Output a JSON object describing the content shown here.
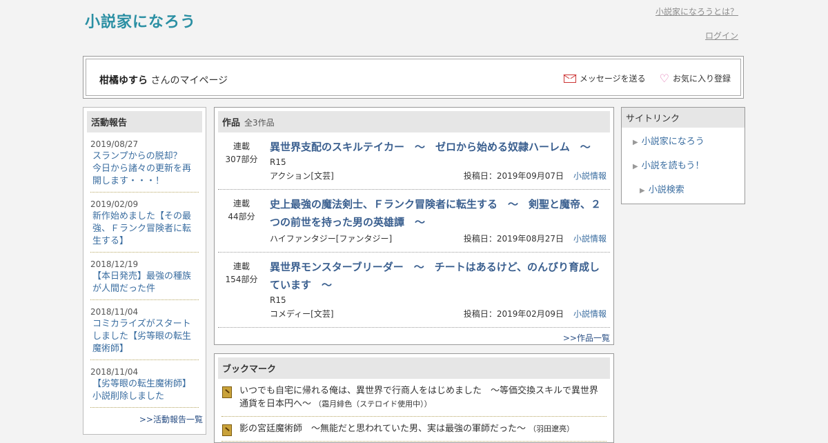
{
  "header": {
    "logo_text": "小説家になろう",
    "about_link": "小説家になろうとは？",
    "login_link": "ログイン"
  },
  "user": {
    "name": "柑橘ゆすら",
    "suffix": "さんのマイページ",
    "send_message": "メッセージを送る",
    "add_favorite": "お気に入り登録"
  },
  "activity": {
    "heading": "活動報告",
    "items": [
      {
        "date": "2019/08/27",
        "title": "スランプからの脱却？　今日から諸々の更新を再開します・・・！"
      },
      {
        "date": "2019/02/09",
        "title": "新作始めました【その最強、Ｆランク冒険者に転生する】"
      },
      {
        "date": "2018/12/19",
        "title": "【本日発売】最強の種族が人間だった件"
      },
      {
        "date": "2018/11/04",
        "title": "コミカライズがスタートしました【劣等眼の転生魔術師】"
      },
      {
        "date": "2018/11/04",
        "title": "【劣等眼の転生魔術師】小説削除しました"
      }
    ],
    "more": ">>活動報告一覧"
  },
  "works": {
    "heading": "作品",
    "count": "全3作品",
    "items": [
      {
        "status": "連載",
        "parts": "307部分",
        "title": "異世界支配のスキルテイカー　～　ゼロから始める奴隷ハーレム　～",
        "rating": "R15",
        "genre": "アクション[文芸]",
        "posted": "投稿日：2019年09月07日",
        "info": "小説情報"
      },
      {
        "status": "連載",
        "parts": "44部分",
        "title": "史上最強の魔法剣士、Ｆランク冒険者に転生する　～　剣聖と魔帝、２つの前世を持った男の英雄譚　～",
        "rating": "",
        "genre": "ハイファンタジー[ファンタジー]",
        "posted": "投稿日：2019年08月27日",
        "info": "小説情報"
      },
      {
        "status": "連載",
        "parts": "154部分",
        "title": "異世界モンスターブリーダー　～　チートはあるけど、のんびり育成しています　～",
        "rating": "R15",
        "genre": "コメディー[文芸]",
        "posted": "投稿日：2019年02月09日",
        "info": "小説情報"
      }
    ],
    "more": ">>作品一覧"
  },
  "bookmarks": {
    "heading": "ブックマーク",
    "items": [
      {
        "title": "いつでも自宅に帰れる俺は、異世界で行商人をはじめました　～等価交換スキルで異世界通貨を日本円へ～",
        "author": "（霜月緋色（ステロイド使用中））"
      },
      {
        "title": "影の宮廷魔術師　～無能だと思われていた男、実は最強の軍師だった～",
        "author": "（羽田遼亮）"
      }
    ]
  },
  "sitelinks": {
    "heading": "サイトリンク",
    "items": [
      "小説家になろう",
      "小説を読もう！",
      "小説検索"
    ]
  },
  "colors": {
    "link": "#3a6da0",
    "title_link": "#3a5f8f",
    "logo": "#2a8fa3"
  }
}
